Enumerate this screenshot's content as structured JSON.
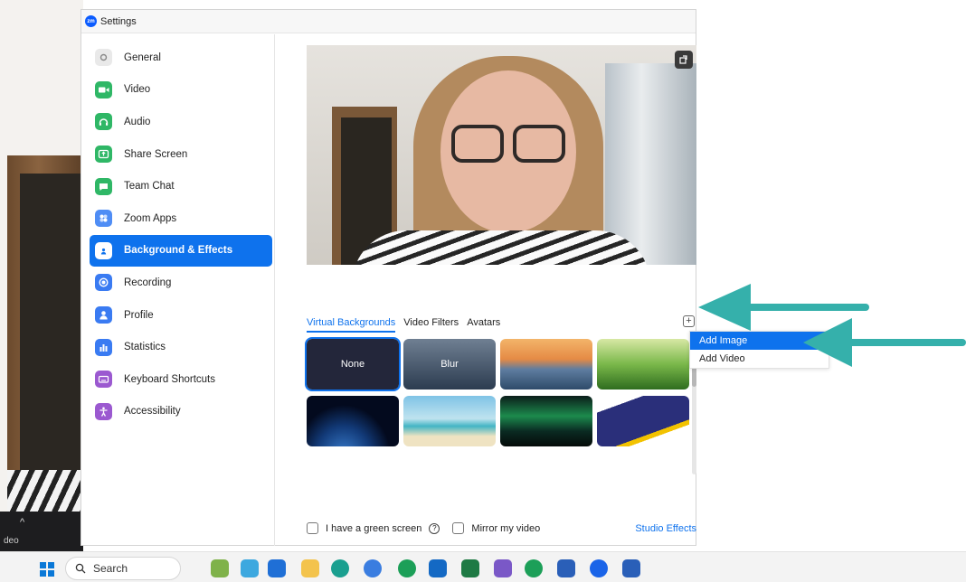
{
  "window": {
    "title": "Settings",
    "app_logo": "zm"
  },
  "background": {
    "partial_label": "deo"
  },
  "sidebar": {
    "items": [
      {
        "label": "General",
        "icon": "gear-icon",
        "color": "#e9e9e9",
        "active": false
      },
      {
        "label": "Video",
        "icon": "video-camera-icon",
        "color": "#2fb766",
        "active": false
      },
      {
        "label": "Audio",
        "icon": "headphones-icon",
        "color": "#2fb766",
        "active": false
      },
      {
        "label": "Share Screen",
        "icon": "share-screen-icon",
        "color": "#2fb766",
        "active": false
      },
      {
        "label": "Team Chat",
        "icon": "chat-icon",
        "color": "#2fb766",
        "active": false
      },
      {
        "label": "Zoom Apps",
        "icon": "apps-icon",
        "color": "#4f8df5",
        "active": false
      },
      {
        "label": "Background & Effects",
        "icon": "person-background-icon",
        "color": "#0e72ed",
        "active": true
      },
      {
        "label": "Recording",
        "icon": "record-icon",
        "color": "#3a7bf2",
        "active": false
      },
      {
        "label": "Profile",
        "icon": "profile-icon",
        "color": "#3a7bf2",
        "active": false
      },
      {
        "label": "Statistics",
        "icon": "bar-chart-icon",
        "color": "#3a7bf2",
        "active": false
      },
      {
        "label": "Keyboard Shortcuts",
        "icon": "keyboard-icon",
        "color": "#9b59d0",
        "active": false
      },
      {
        "label": "Accessibility",
        "icon": "accessibility-icon",
        "color": "#9b59d0",
        "active": false
      }
    ]
  },
  "content": {
    "tabs": [
      {
        "label": "Virtual Backgrounds",
        "active": true
      },
      {
        "label": "Video Filters",
        "active": false
      },
      {
        "label": "Avatars",
        "active": false
      }
    ],
    "add_button_symbol": "+",
    "backgrounds": [
      {
        "id": "none",
        "label": "None",
        "selected": true
      },
      {
        "id": "blur",
        "label": "Blur",
        "selected": false
      },
      {
        "id": "bridge",
        "label": "",
        "selected": false
      },
      {
        "id": "grass",
        "label": "",
        "selected": false
      },
      {
        "id": "earth",
        "label": "",
        "selected": false
      },
      {
        "id": "beach",
        "label": "",
        "selected": false
      },
      {
        "id": "aurora",
        "label": "",
        "selected": false
      },
      {
        "id": "abstract",
        "label": "",
        "selected": false
      }
    ],
    "add_menu": [
      {
        "label": "Add Image",
        "highlighted": true
      },
      {
        "label": "Add Video",
        "highlighted": false
      }
    ],
    "footer": {
      "green_screen_label": "I have a green screen",
      "help_symbol": "?",
      "mirror_label": "Mirror my video",
      "studio_effects_label": "Studio Effects"
    }
  },
  "taskbar": {
    "search_label": "Search"
  },
  "colors": {
    "accent": "#0e72ed",
    "arrow": "#35b0ab"
  }
}
